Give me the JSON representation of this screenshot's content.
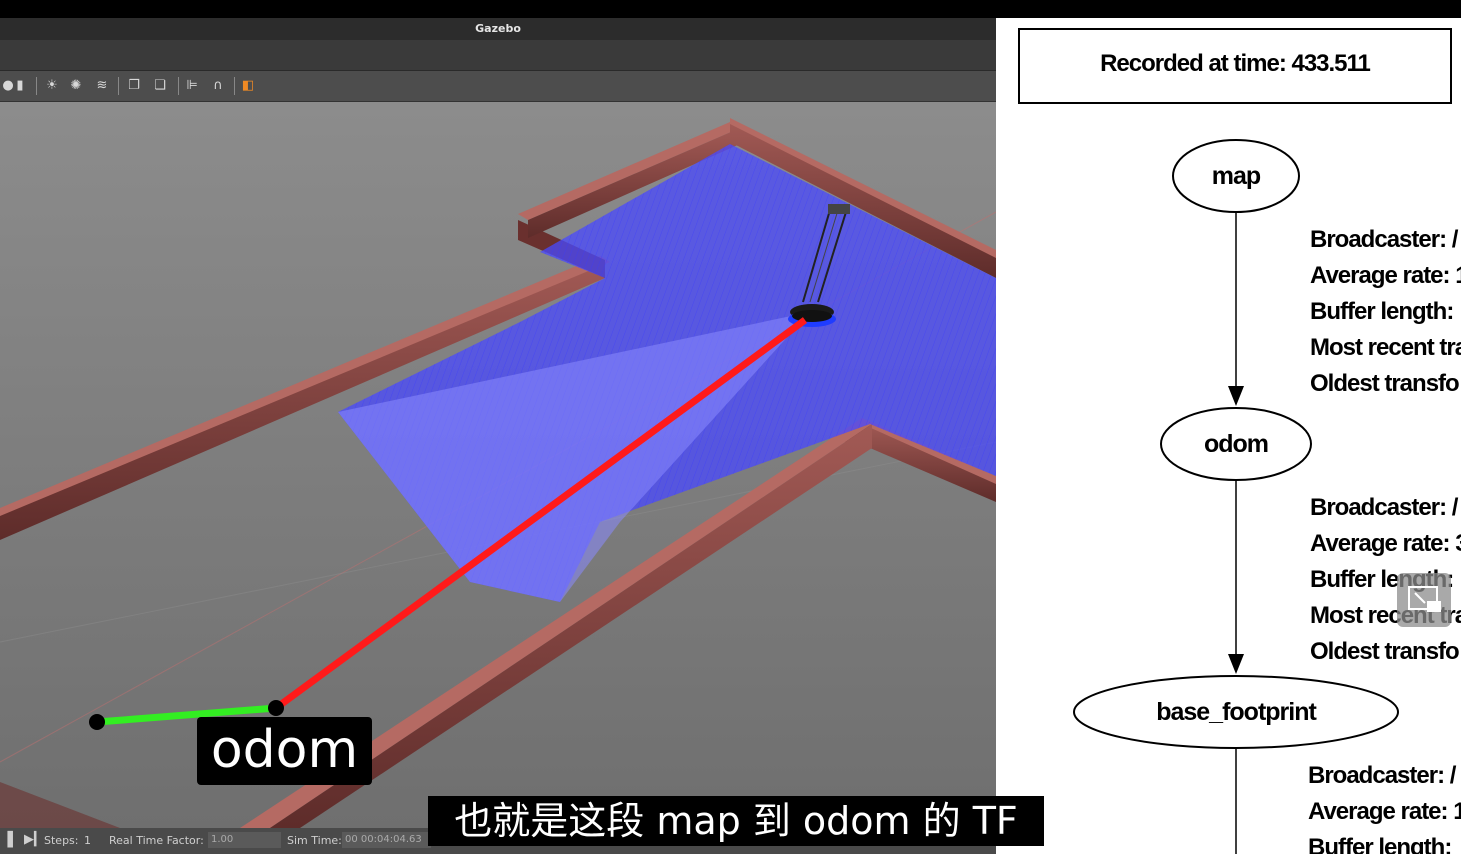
{
  "gazebo": {
    "window_title": "Gazebo",
    "status": {
      "steps_label": "Steps:",
      "steps_value": "1",
      "rtf_label": "Real Time Factor:",
      "rtf_value": "1.00",
      "sim_time_label": "Sim Time:",
      "sim_time_value": "00 00:04:04.63"
    }
  },
  "tf_graph": {
    "recorded": "Recorded at time: 433.511",
    "nodes": [
      "map",
      "odom",
      "base_footprint"
    ],
    "edge1": [
      "Broadcaster: /",
      "Average rate: 1",
      "Buffer length:",
      "Most recent tra",
      "Oldest transfo"
    ],
    "edge2": [
      "Broadcaster: /",
      "Average rate: 3",
      "Buffer length:",
      "Most recent tra",
      "Oldest transfo"
    ],
    "edge3": [
      "Broadcaster: /",
      "Average rate: 1",
      "Buffer length:"
    ]
  },
  "overlay": {
    "caption": "odom",
    "subtitle": "也就是这段 map 到 odom 的 TF"
  },
  "colors": {
    "map_to_odom": "#ff1a1a",
    "odom_link": "#33ee22",
    "laser": "#4a4aff",
    "wall": "#7a3a38"
  }
}
